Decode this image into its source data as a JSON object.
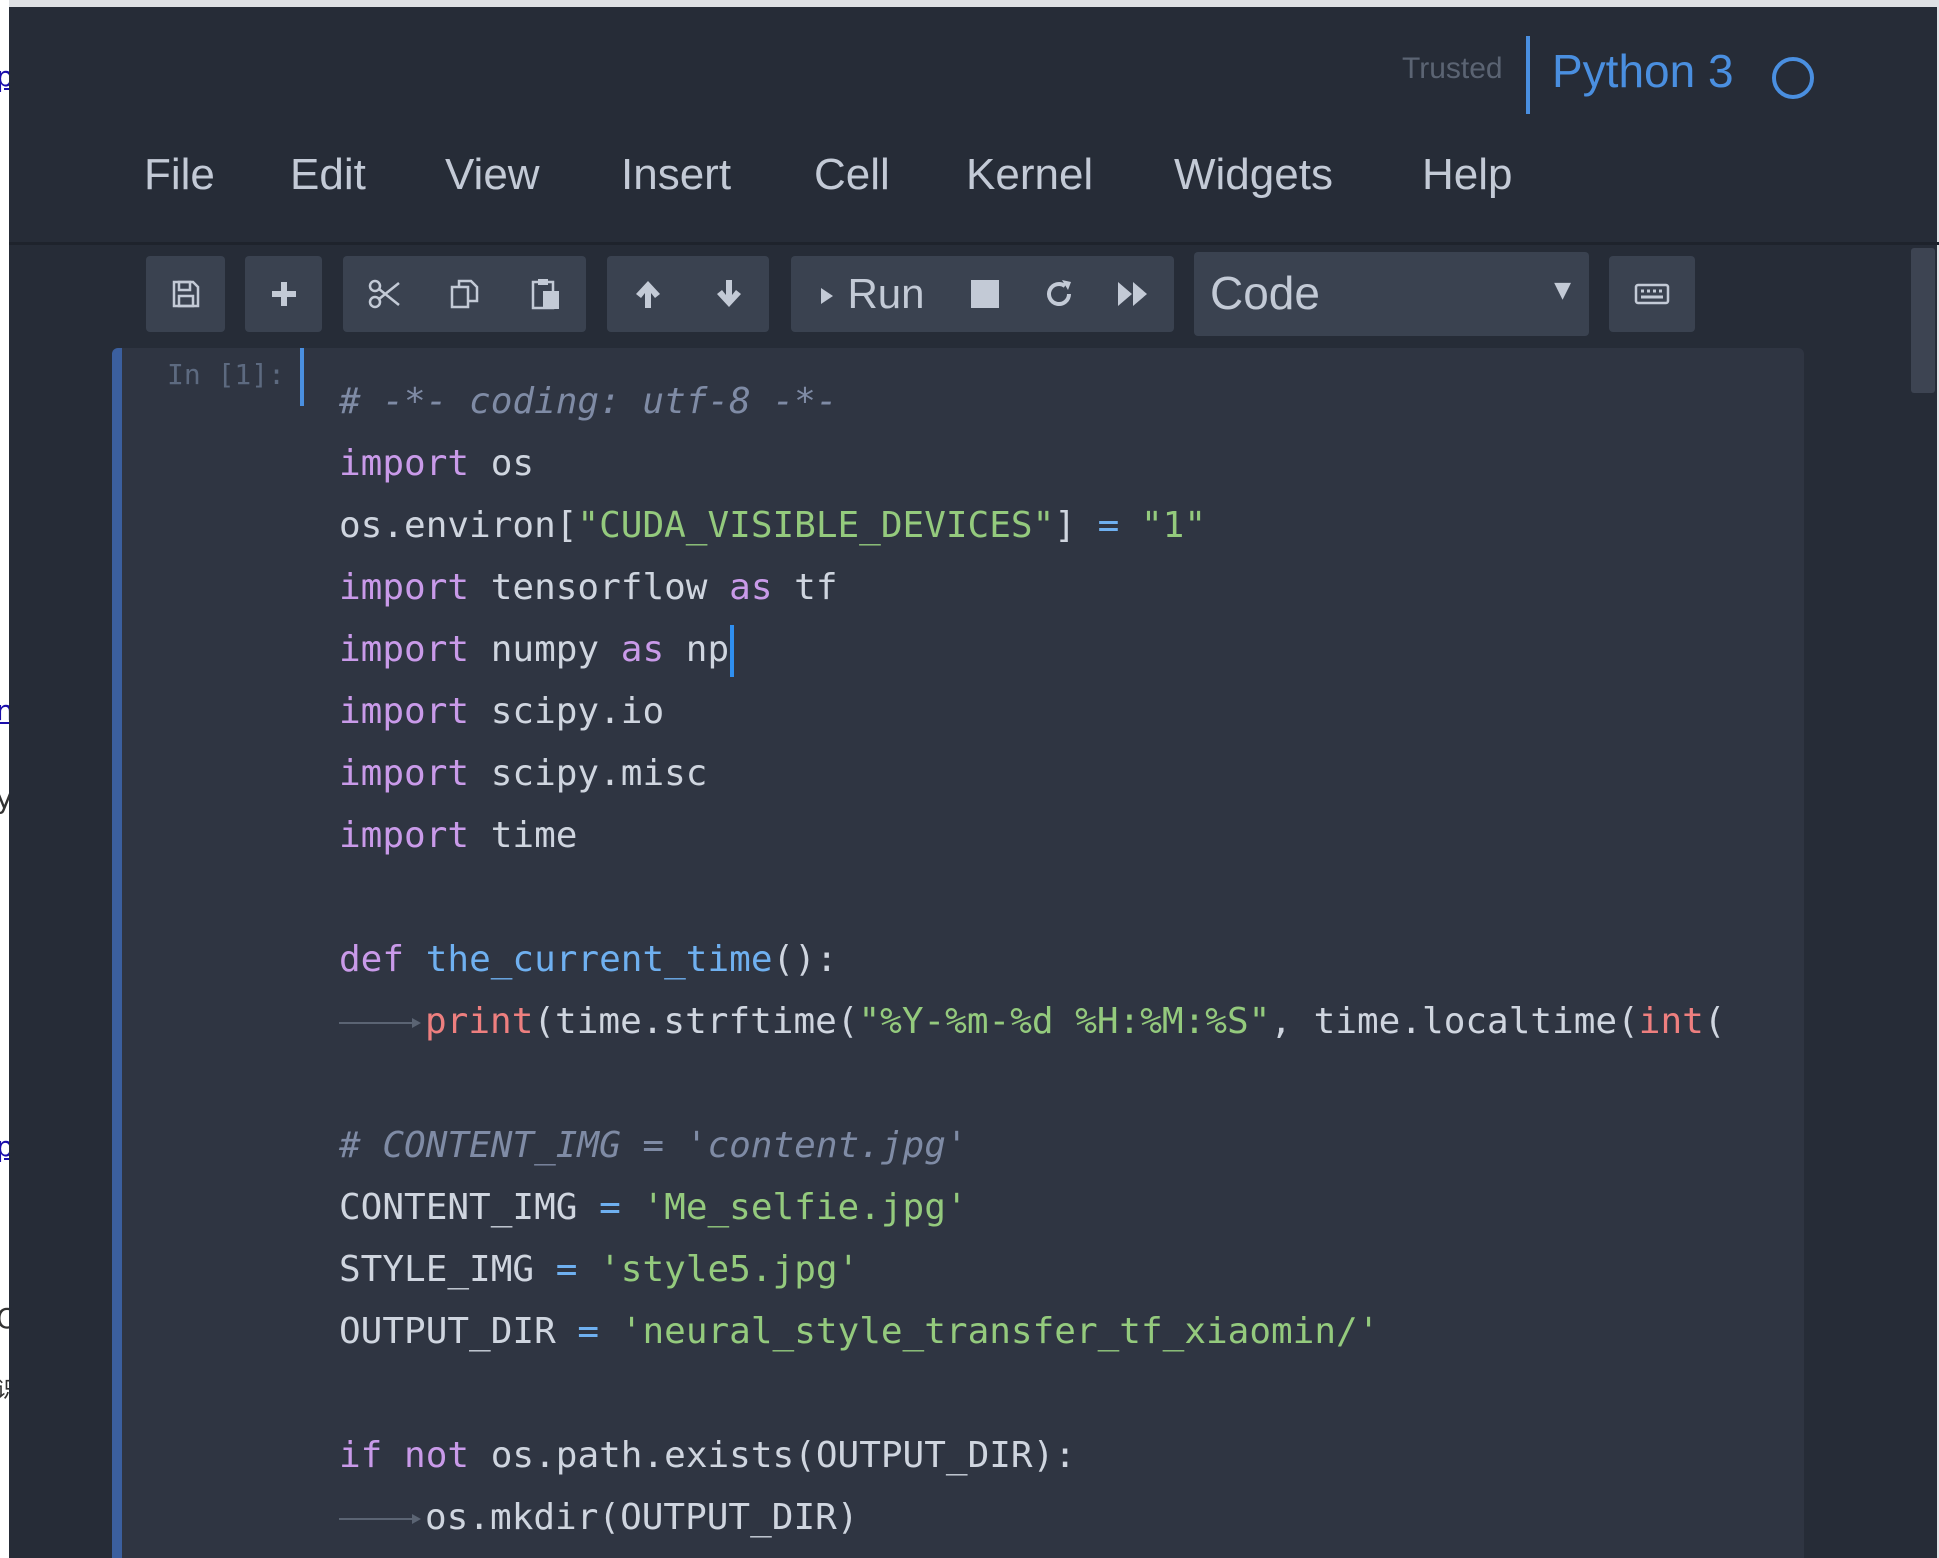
{
  "left_margin": {
    "fragments": [
      "p",
      "n",
      "y",
      "p",
      "O",
      "识"
    ]
  },
  "header": {
    "trusted_label": "Trusted",
    "kernel_name": "Python 3",
    "kernel_status_icon": "kernel-idle-circle-icon"
  },
  "menu": {
    "items": [
      "File",
      "Edit",
      "View",
      "Insert",
      "Cell",
      "Kernel",
      "Widgets",
      "Help"
    ]
  },
  "toolbar": {
    "icons": [
      "save-icon",
      "insert-cell-icon",
      "cut-icon",
      "copy-icon",
      "paste-icon",
      "move-up-icon",
      "move-down-icon",
      "run-icon",
      "interrupt-icon",
      "restart-icon",
      "restart-run-all-icon",
      "keyboard-icon"
    ],
    "run_label": "Run",
    "cell_type": "Code"
  },
  "cell": {
    "prompt": "In [1]:",
    "lines": {
      "l1": "# -*- coding: utf-8 -*-",
      "l2_kw": "import",
      "l2_rest": " os",
      "l3_a": "os.environ[",
      "l3_str": "\"CUDA_VISIBLE_DEVICES\"",
      "l3_b": "] ",
      "l3_op": "=",
      "l3_sp": " ",
      "l3_str2": "\"1\"",
      "l4_kw": "import",
      "l4_a": " tensorflow ",
      "l4_as": "as",
      "l4_b": " tf",
      "l5_kw": "import",
      "l5_a": " numpy ",
      "l5_as": "as",
      "l5_b": " np",
      "l6_kw": "import",
      "l6_rest": " scipy.io",
      "l7_kw": "import",
      "l7_rest": " scipy.misc",
      "l8_kw": "import",
      "l8_rest": " time",
      "l10_def": "def",
      "l10_sp": " ",
      "l10_fn": "the_current_time",
      "l10_rest": "():",
      "l11_print": "print",
      "l11_a": "(time.strftime(",
      "l11_str": "\"%Y-%m-%d %H:%M:%S\"",
      "l11_b": ", time.localtime(",
      "l11_int": "int",
      "l11_c": "(",
      "l13": "# CONTENT_IMG = 'content.jpg'",
      "l14_a": "CONTENT_IMG ",
      "l14_op": "=",
      "l14_sp": " ",
      "l14_str": "'Me_selfie.jpg'",
      "l15_a": "STYLE_IMG ",
      "l15_op": "=",
      "l15_sp": " ",
      "l15_str": "'style5.jpg'",
      "l16_a": "OUTPUT_DIR ",
      "l16_op": "=",
      "l16_sp": " ",
      "l16_str": "'neural_style_transfer_tf_xiaomin/'",
      "l18_if": "if",
      "l18_sp": " ",
      "l18_not": "not",
      "l18_rest": " os.path.exists(OUTPUT_DIR):",
      "l19_rest": "os.mkdir(OUTPUT_DIR)"
    }
  }
}
